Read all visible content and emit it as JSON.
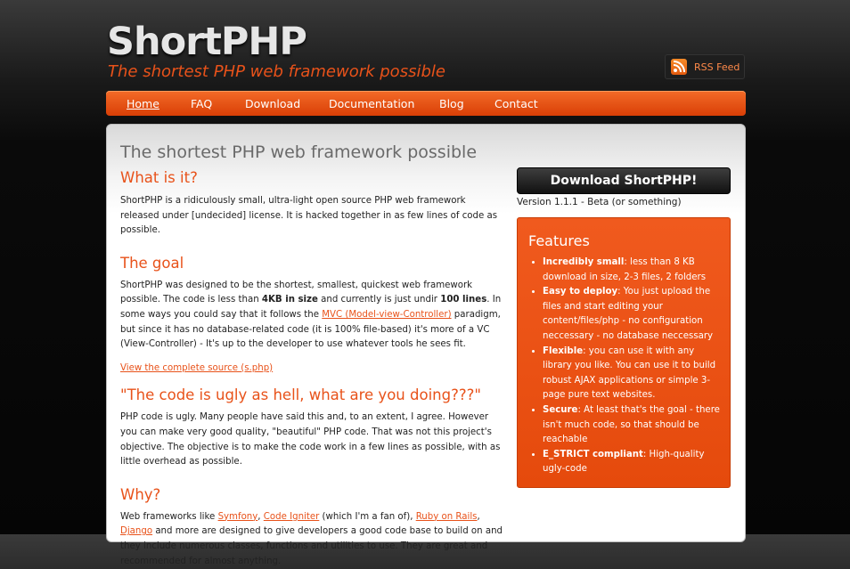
{
  "header": {
    "logo": "ShortPHP",
    "tagline": "The shortest PHP web framework possible",
    "rss_label": "RSS Feed"
  },
  "nav": {
    "items": [
      "Home",
      "FAQ",
      "Download",
      "Documentation",
      "Blog",
      "Contact"
    ]
  },
  "main": {
    "page_title": "The shortest PHP web framework possible",
    "sections": {
      "what": {
        "heading": "What is it?",
        "text": "ShortPHP is a ridiculously small, ultra-light open source PHP web framework released under [undecided] license. It is hacked together in as few lines of code as possible."
      },
      "goal": {
        "heading": "The goal",
        "t1": "ShortPHP was designed to be the shortest, smallest, quickest web framework possible. The code is less than ",
        "b1": "4KB in size",
        "t2": " and currently is just undir ",
        "b2": "100 lines",
        "t3": ". In some ways you could say that it follows the ",
        "link": "MVC (Model-view-Controller)",
        "t4": " paradigm, but since it has no database-related code (it is 100% file-based) it's more of a VC (View-Controller) - It's up to the developer to use whatever tools he sees fit.",
        "source_link": "View the complete source (s.php)"
      },
      "ugly": {
        "heading": "\"The code is ugly as hell, what are you doing???\"",
        "text": "PHP code is ugly. Many people have said this and, to an extent, I agree. However you can make very good quality, \"beautiful\" PHP code. That was not this project's objective. The objective is to make the code work in a few lines as possible, with as little overhead as possible."
      },
      "why": {
        "heading": "Why?",
        "t1": "Web frameworks like ",
        "l1": "Symfony",
        "t2": ", ",
        "l2": "Code Igniter",
        "t3": " (which I'm a fan of), ",
        "l3": "Ruby on Rails",
        "t4": ", ",
        "l4": "Django",
        "t5": " and more are designed to give developers a good code base to build on and they include numerous classes, functions and utilities to use. They are great and recommended for almost anything."
      }
    }
  },
  "sidebar": {
    "download_button": "Download ShortPHP!",
    "version": "Version 1.1.1 - Beta (or something)",
    "features_title": "Features",
    "features": [
      {
        "bold": "Incredibly small",
        "text": ": less than 8 KB download in size, 2-3 files, 2 folders"
      },
      {
        "bold": "Easy to deploy",
        "text": ": You just upload the files and start editing your content/files/php - no configuration neccessary - no database neccessary"
      },
      {
        "bold": "Flexible",
        "text": ": you can use it with any library you like. You can use it to build robust AJAX applications or simple 3-page pure text websites."
      },
      {
        "bold": "Secure",
        "text": ": At least that's the goal - there isn't much code, so that should be reachable"
      },
      {
        "bold": "E_STRICT compliant",
        "text": ": High-quality ugly-code"
      }
    ]
  },
  "colors": {
    "accent": "#e8521a",
    "nav_top": "#f36b28",
    "nav_bottom": "#d93f06",
    "background": "#0a0a0a"
  }
}
